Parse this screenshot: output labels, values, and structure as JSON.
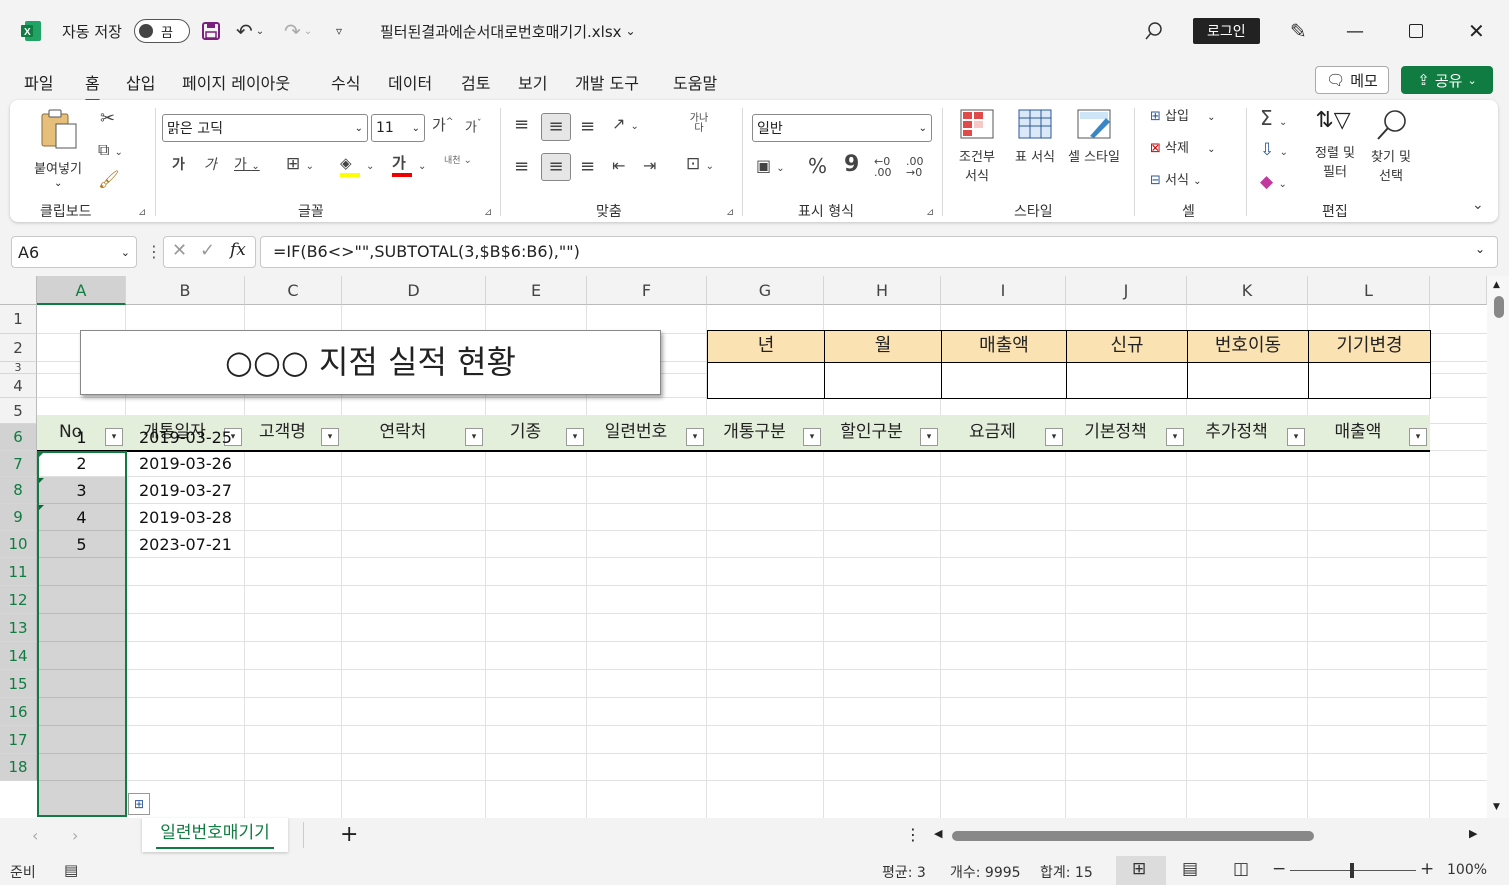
{
  "titlebar": {
    "autosave_label": "자동 저장",
    "autosave_state": "끔",
    "filename": "필터된결과에순서대로번호매기기.xlsx",
    "login_label": "로그인"
  },
  "tabs": [
    "파일",
    "홈",
    "삽입",
    "페이지 레이아웃",
    "수식",
    "데이터",
    "검토",
    "보기",
    "개발 도구",
    "도움말"
  ],
  "memo_label": "메모",
  "share_label": "공유",
  "ribbon": {
    "paste_label": "붙여넣기",
    "font_name": "맑은 고딕",
    "font_size": "11",
    "bold": "가",
    "italic": "가",
    "underline": "가",
    "wrap": "내천",
    "font_color_glyph": "가",
    "grow_font": "가",
    "shrink_font": "가",
    "lang_glyph": "가나다",
    "number_format": "일반",
    "percent": "%",
    "comma": "9",
    "cond_format": "조건부 서식",
    "table_format": "표 서식",
    "cell_style": "셀 스타일",
    "insert": "삽입",
    "delete": "삭제",
    "format": "서식",
    "sort_filter": "정렬 및 필터",
    "find_select": "찾기 및 선택",
    "groups": [
      "클립보드",
      "글꼴",
      "맞춤",
      "표시 형식",
      "스타일",
      "셀",
      "편집"
    ]
  },
  "formula": {
    "namebox": "A6",
    "fx": "fx",
    "value": "=IF(B6<>\"\",SUBTOTAL(3,$B$6:B6),\"\")"
  },
  "columns": [
    "A",
    "B",
    "C",
    "D",
    "E",
    "F",
    "G",
    "H",
    "I",
    "J",
    "K",
    "L"
  ],
  "rows": [
    "1",
    "2",
    "3",
    "4",
    "5",
    "6",
    "7",
    "8",
    "9",
    "10",
    "11",
    "12",
    "13",
    "14",
    "15",
    "16",
    "17",
    "18"
  ],
  "sheet": {
    "title": "○○○ 지점  실적 현황",
    "summary_headers": [
      "년",
      "월",
      "매출액",
      "신규",
      "번호이동",
      "기기변경"
    ],
    "table_headers": [
      "No",
      "개통일자",
      "고객명",
      "연락처",
      "기종",
      "일련번호",
      "개통구분",
      "할인구분",
      "요금제",
      "기본정책",
      "추가정책",
      "매출액"
    ],
    "data": [
      [
        "1",
        "2019-03-25"
      ],
      [
        "2",
        "2019-03-26"
      ],
      [
        "3",
        "2019-03-27"
      ],
      [
        "4",
        "2019-03-28"
      ],
      [
        "5",
        "2023-07-21"
      ]
    ]
  },
  "sheet_tab": "일련번호매기기",
  "status": {
    "ready": "준비",
    "average": "평균: 3",
    "count": "개수: 9995",
    "sum": "합계: 15",
    "zoom": "100%"
  },
  "colors": {
    "accent": "#107c41",
    "header_fill": "#fbe2b3",
    "table_header_fill": "#e3eedb"
  }
}
